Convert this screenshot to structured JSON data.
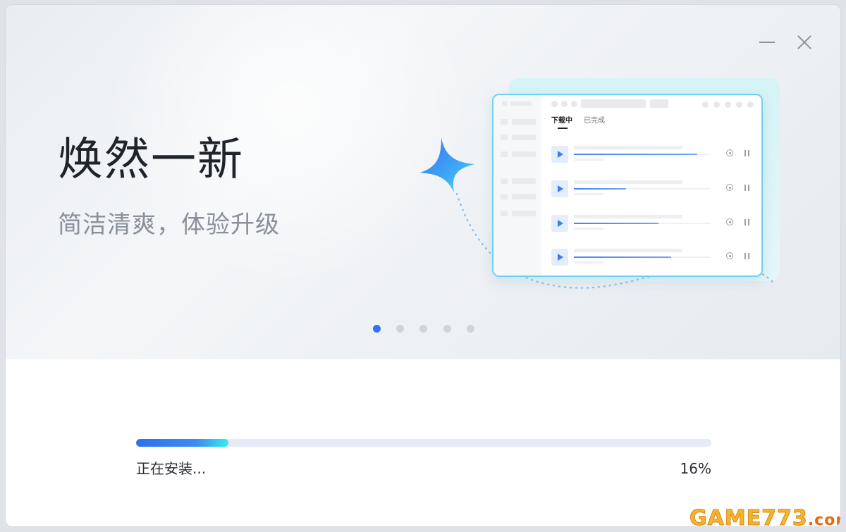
{
  "window": {
    "controls": {
      "minimize_icon": "minimize-icon",
      "close_icon": "close-icon"
    }
  },
  "hero": {
    "title": "焕然一新",
    "subtitle": "简洁清爽，体验升级",
    "illustration": {
      "tabs": [
        "下载中",
        "已完成"
      ],
      "download_items": [
        {
          "progress": 0.9
        },
        {
          "progress": 0.38
        },
        {
          "progress": 0.62
        },
        {
          "progress": 0.71
        }
      ]
    },
    "pager": {
      "count": 5,
      "active_index": 0
    }
  },
  "install": {
    "status": "正在安装...",
    "progress_percent": 16,
    "percent_label": "16%"
  },
  "watermark": {
    "text": "GAME773",
    "tld": ".com"
  },
  "colors": {
    "accent": "#2e74f5",
    "progress_end": "#2ff0ee",
    "title": "#1f242b",
    "subtitle": "#8a9099"
  }
}
